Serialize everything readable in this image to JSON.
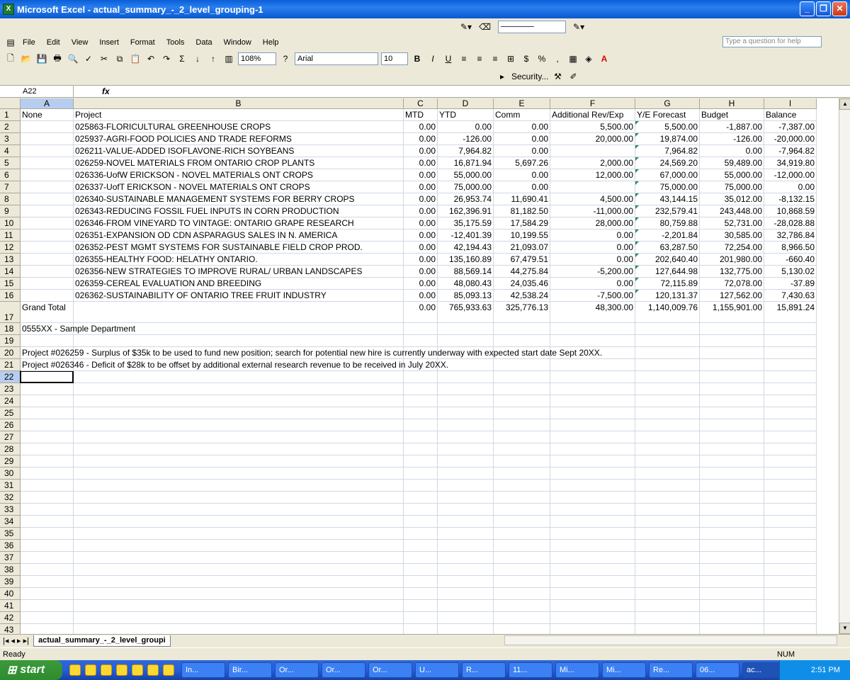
{
  "window": {
    "title": "Microsoft Excel - actual_summary_-_2_level_grouping-1"
  },
  "menu": [
    "File",
    "Edit",
    "View",
    "Insert",
    "Format",
    "Tools",
    "Data",
    "Window",
    "Help"
  ],
  "help_placeholder": "Type a question for help",
  "toolbar": {
    "zoom": "108%",
    "font": "Arial",
    "font_size": "10",
    "security": "Security..."
  },
  "formula_bar": {
    "name_box": "A22",
    "fx": "fx",
    "content": ""
  },
  "columns": [
    "A",
    "B",
    "C",
    "D",
    "E",
    "F",
    "G",
    "H",
    "I"
  ],
  "rows": [
    {
      "n": "1",
      "a": "None",
      "b": "Project",
      "c": "MTD",
      "d": "YTD",
      "e": "Comm",
      "f": "Additional Rev/Exp",
      "g": "Y/E Forecast",
      "h": "Budget",
      "i": "Balance"
    },
    {
      "n": "2",
      "a": "",
      "b": "025863-FLORICULTURAL GREENHOUSE CROPS",
      "c": "0.00",
      "d": "0.00",
      "e": "0.00",
      "f": "5,500.00",
      "g": "5,500.00",
      "h": "-1,887.00",
      "i": "-7,387.00"
    },
    {
      "n": "3",
      "a": "",
      "b": "025937-AGRI-FOOD POLICIES AND TRADE REFORMS",
      "c": "0.00",
      "d": "-126.00",
      "e": "0.00",
      "f": "20,000.00",
      "g": "19,874.00",
      "h": "-126.00",
      "i": "-20,000.00"
    },
    {
      "n": "4",
      "a": "",
      "b": "026211-VALUE-ADDED ISOFLAVONE-RICH SOYBEANS",
      "c": "0.00",
      "d": "7,964.82",
      "e": "0.00",
      "f": "",
      "g": "7,964.82",
      "h": "0.00",
      "i": "-7,964.82"
    },
    {
      "n": "5",
      "a": "",
      "b": "026259-NOVEL MATERIALS FROM ONTARIO CROP PLANTS",
      "c": "0.00",
      "d": "16,871.94",
      "e": "5,697.26",
      "f": "2,000.00",
      "g": "24,569.20",
      "h": "59,489.00",
      "i": "34,919.80"
    },
    {
      "n": "6",
      "a": "",
      "b": "026336-UofW ERICKSON - NOVEL MATERIALS ONT CROPS",
      "c": "0.00",
      "d": "55,000.00",
      "e": "0.00",
      "f": "12,000.00",
      "g": "67,000.00",
      "h": "55,000.00",
      "i": "-12,000.00"
    },
    {
      "n": "7",
      "a": "",
      "b": "026337-UofT ERICKSON -  NOVEL MATERIALS ONT CROPS",
      "c": "0.00",
      "d": "75,000.00",
      "e": "0.00",
      "f": "",
      "g": "75,000.00",
      "h": "75,000.00",
      "i": "0.00"
    },
    {
      "n": "8",
      "a": "",
      "b": "026340-SUSTAINABLE MANAGEMENT SYSTEMS FOR BERRY CROPS",
      "c": "0.00",
      "d": "26,953.74",
      "e": "11,690.41",
      "f": "4,500.00",
      "g": "43,144.15",
      "h": "35,012.00",
      "i": "-8,132.15"
    },
    {
      "n": "9",
      "a": "",
      "b": "026343-REDUCING FOSSIL FUEL INPUTS IN CORN PRODUCTION",
      "c": "0.00",
      "d": "162,396.91",
      "e": "81,182.50",
      "f": "-11,000.00",
      "g": "232,579.41",
      "h": "243,448.00",
      "i": "10,868.59"
    },
    {
      "n": "10",
      "a": "",
      "b": "026346-FROM VINEYARD TO VINTAGE: ONTARIO GRAPE RESEARCH",
      "c": "0.00",
      "d": "35,175.59",
      "e": "17,584.29",
      "f": "28,000.00",
      "g": "80,759.88",
      "h": "52,731.00",
      "i": "-28,028.88"
    },
    {
      "n": "11",
      "a": "",
      "b": "026351-EXPANSION OD CDN ASPARAGUS SALES IN N. AMERICA",
      "c": "0.00",
      "d": "-12,401.39",
      "e": "10,199.55",
      "f": "0.00",
      "g": "-2,201.84",
      "h": "30,585.00",
      "i": "32,786.84"
    },
    {
      "n": "12",
      "a": "",
      "b": "026352-PEST MGMT SYSTEMS FOR SUSTAINABLE FIELD CROP PROD.",
      "c": "0.00",
      "d": "42,194.43",
      "e": "21,093.07",
      "f": "0.00",
      "g": "63,287.50",
      "h": "72,254.00",
      "i": "8,966.50"
    },
    {
      "n": "13",
      "a": "",
      "b": "026355-HEALTHY FOOD: HELATHY ONTARIO.",
      "c": "0.00",
      "d": "135,160.89",
      "e": "67,479.51",
      "f": "0.00",
      "g": "202,640.40",
      "h": "201,980.00",
      "i": "-660.40"
    },
    {
      "n": "14",
      "a": "",
      "b": "026356-NEW STRATEGIES TO IMPROVE RURAL/ URBAN LANDSCAPES",
      "c": "0.00",
      "d": "88,569.14",
      "e": "44,275.84",
      "f": "-5,200.00",
      "g": "127,644.98",
      "h": "132,775.00",
      "i": "5,130.02"
    },
    {
      "n": "15",
      "a": "",
      "b": "026359-CEREAL EVALUATION AND BREEDING",
      "c": "0.00",
      "d": "48,080.43",
      "e": "24,035.46",
      "f": "0.00",
      "g": "72,115.89",
      "h": "72,078.00",
      "i": "-37.89"
    },
    {
      "n": "16",
      "a": "",
      "b": "026362-SUSTAINABILITY OF ONTARIO TREE FRUIT INDUSTRY",
      "c": "0.00",
      "d": "85,093.13",
      "e": "42,538.24",
      "f": "-7,500.00",
      "g": "120,131.37",
      "h": "127,562.00",
      "i": "7,430.63"
    },
    {
      "n": "17",
      "a": "Grand Total",
      "b": "",
      "c": "0.00",
      "d": "765,933.63",
      "e": "325,776.13",
      "f": "48,300.00",
      "g": "1,140,009.76",
      "h": "1,155,901.00",
      "i": "15,891.24"
    },
    {
      "n": "18",
      "a": "0555XX - Sample Department",
      "b": "",
      "c": "",
      "d": "",
      "e": "",
      "f": "",
      "g": "",
      "h": "",
      "i": ""
    },
    {
      "n": "19",
      "a": "",
      "b": "",
      "c": "",
      "d": "",
      "e": "",
      "f": "",
      "g": "",
      "h": "",
      "i": ""
    },
    {
      "n": "20",
      "a": "Project #026259 - Surplus of $35k to be used to fund new position; search for potential new hire is currently underway with expected start date Sept 20XX.",
      "b": "",
      "c": "",
      "d": "",
      "e": "",
      "f": "",
      "g": "",
      "h": "",
      "i": ""
    },
    {
      "n": "21",
      "a": "Project #026346 - Deficit of $28k to be offset by additional external research revenue to be received in July 20XX.",
      "b": "",
      "c": "",
      "d": "",
      "e": "",
      "f": "",
      "g": "",
      "h": "",
      "i": ""
    }
  ],
  "empty_rows": [
    "22",
    "23",
    "24",
    "25",
    "26",
    "27",
    "28",
    "29",
    "30",
    "31",
    "32",
    "33",
    "34",
    "35",
    "36",
    "37",
    "38",
    "39",
    "40",
    "41",
    "42",
    "43"
  ],
  "sheet_tab": "actual_summary_-_2_level_groupi",
  "status": {
    "left": "Ready",
    "num": "NUM"
  },
  "taskbar": {
    "start": "start",
    "buttons": [
      "In...",
      "Bir...",
      "Or...",
      "Or...",
      "Or...",
      "U...",
      "R...",
      "11...",
      "Mi...",
      "Mi...",
      "Re...",
      "06...",
      "ac..."
    ],
    "clock": "2:51 PM"
  }
}
